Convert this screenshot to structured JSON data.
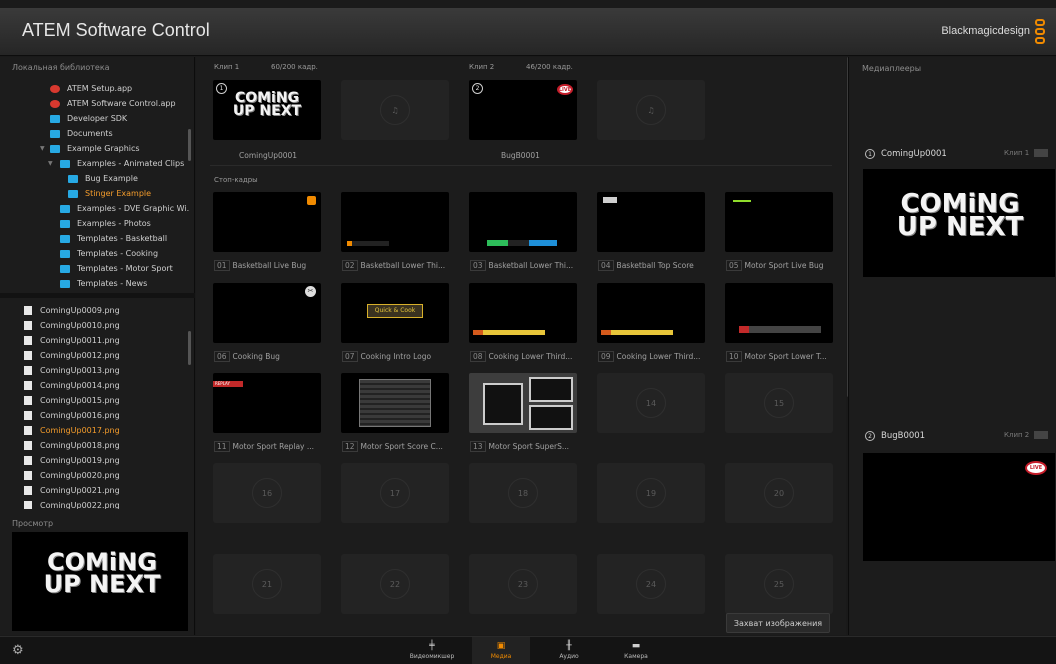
{
  "app": {
    "title": "ATEM Software Control",
    "brand": "Blackmagicdesign"
  },
  "left": {
    "library_label": "Локальная библиотека",
    "tree": [
      {
        "label": "ATEM Setup.app",
        "icon": "app-icon"
      },
      {
        "label": "ATEM Software Control.app",
        "icon": "app-icon"
      },
      {
        "label": "Developer SDK",
        "icon": "folder-icon"
      },
      {
        "label": "Documents",
        "icon": "folder-icon"
      },
      {
        "label": "Example Graphics",
        "icon": "folder-icon"
      },
      {
        "label": "Examples - Animated Clips",
        "icon": "folder-icon"
      },
      {
        "label": "Bug Example",
        "icon": "folder-icon"
      },
      {
        "label": "Stinger Example",
        "icon": "folder-icon",
        "selected": true
      },
      {
        "label": "Examples - DVE Graphic Wi...",
        "icon": "folder-icon"
      },
      {
        "label": "Examples - Photos",
        "icon": "folder-icon"
      },
      {
        "label": "Templates - Basketball",
        "icon": "folder-icon"
      },
      {
        "label": "Templates - Cooking",
        "icon": "folder-icon"
      },
      {
        "label": "Templates - Motor Sport",
        "icon": "folder-icon"
      },
      {
        "label": "Templates - News",
        "icon": "folder-icon"
      }
    ],
    "files": [
      "ComingUp0009.png",
      "ComingUp0010.png",
      "ComingUp0011.png",
      "ComingUp0012.png",
      "ComingUp0013.png",
      "ComingUp0014.png",
      "ComingUp0015.png",
      "ComingUp0016.png",
      "ComingUp0017.png",
      "ComingUp0018.png",
      "ComingUp0019.png",
      "ComingUp0020.png",
      "ComingUp0021.png",
      "ComingUp0022.png"
    ],
    "selected_file": "ComingUp0017.png",
    "preview_label": "Просмотр",
    "preview_art": {
      "line1": "COMiNG",
      "line2": "UP NEXT"
    }
  },
  "center": {
    "clip1": {
      "label": "Клип 1",
      "frames": "60/200 кадр.",
      "badge": "1",
      "caption": "ComingUp0001",
      "art1": "COMiNG",
      "art2": "UP NEXT"
    },
    "clip2": {
      "label": "Клип 2",
      "frames": "46/200 кадр.",
      "badge": "2",
      "caption": "BugB0001",
      "live": "LIVE"
    },
    "stills_label": "Стоп-кадры",
    "stills": [
      {
        "num": "01",
        "name": "Basketball Live Bug"
      },
      {
        "num": "02",
        "name": "Basketball Lower Thi..."
      },
      {
        "num": "03",
        "name": "Basketball Lower Thi..."
      },
      {
        "num": "04",
        "name": "Basketball Top Score"
      },
      {
        "num": "05",
        "name": "Motor Sport Live Bug"
      },
      {
        "num": "06",
        "name": "Cooking Bug"
      },
      {
        "num": "07",
        "name": "Cooking Intro Logo"
      },
      {
        "num": "08",
        "name": "Cooking Lower Third..."
      },
      {
        "num": "09",
        "name": "Cooking Lower Third..."
      },
      {
        "num": "10",
        "name": "Motor Sport Lower T..."
      },
      {
        "num": "11",
        "name": "Motor Sport Replay ..."
      },
      {
        "num": "12",
        "name": "Motor Sport Score C..."
      },
      {
        "num": "13",
        "name": "Motor Sport SuperS..."
      }
    ],
    "graphic_texts": {
      "cooking_logo": "Quick & Cook",
      "replay": "REPLAY"
    },
    "empty_slots": [
      "14",
      "15",
      "16",
      "17",
      "18",
      "19",
      "20",
      "21",
      "22",
      "23",
      "24",
      "25"
    ],
    "capture_button": "Захват изображения"
  },
  "right": {
    "title": "Медиаплееры",
    "players": [
      {
        "num": "1",
        "name": "ComingUp0001",
        "clip": "Клип 1",
        "art1": "COMiNG",
        "art2": "UP NEXT"
      },
      {
        "num": "2",
        "name": "BugB0001",
        "clip": "Клип 2",
        "live": "LIVE"
      }
    ]
  },
  "bottom": {
    "nav": [
      {
        "label": "Видеомикшер",
        "icon": "switcher-icon"
      },
      {
        "label": "Медиа",
        "icon": "media-icon",
        "active": true
      },
      {
        "label": "Аудио",
        "icon": "audio-icon"
      },
      {
        "label": "Камера",
        "icon": "camera-icon"
      }
    ]
  },
  "colors": {
    "accent": "#f08a00",
    "selected_text": "#f39c2c",
    "folder": "#27a9e3"
  }
}
